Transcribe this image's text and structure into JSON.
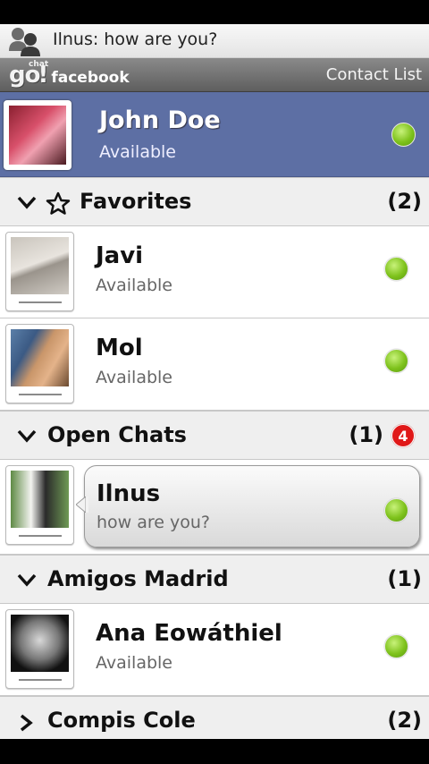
{
  "notification": {
    "text": "Ilnus: how are you?"
  },
  "appbar": {
    "logo_go": "go",
    "logo_chat": "chat",
    "logo_facebook": "facebook",
    "contact_list": "Contact List"
  },
  "me": {
    "name": "John Doe",
    "status": "Available"
  },
  "groups": [
    {
      "label": "Favorites",
      "count": "(2)"
    },
    {
      "label": "Open Chats",
      "count": "(1)",
      "badge": "4"
    },
    {
      "label": "Amigos Madrid",
      "count": "(1)"
    },
    {
      "label": "Compis Cole",
      "count": "(2)"
    }
  ],
  "contacts": {
    "javi": {
      "name": "Javi",
      "status": "Available"
    },
    "mol": {
      "name": "Mol",
      "status": "Available"
    },
    "ilnus": {
      "name": "Ilnus",
      "status": "how are you?"
    },
    "ana": {
      "name": "Ana Eowáthiel",
      "status": "Available"
    }
  },
  "colors": {
    "me_bg": "#5d6fa4",
    "online": "#7ec21c",
    "badge": "#e01818"
  }
}
